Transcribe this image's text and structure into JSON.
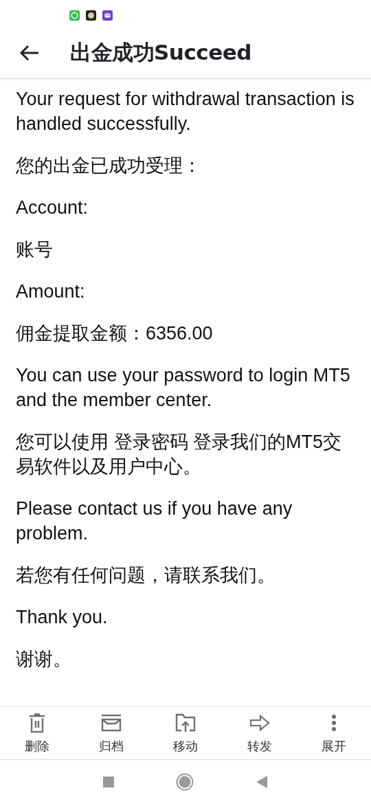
{
  "header": {
    "title": "出金成功Succeed"
  },
  "message": {
    "paragraphs": [
      "Your request for withdrawal transaction is handled successfully.",
      "您的出金已成功受理：",
      "Account:",
      "账号",
      "Amount:",
      "佣金提取金额：6356.00",
      "You can use your password to login MT5 and the member center.",
      "您可以使用 登录密码 登录我们的MT5交易软件以及用户中心。",
      "Please contact us if you have any problem.",
      "若您有任何问题，请联系我们。",
      "Thank you.",
      "谢谢。"
    ]
  },
  "toolbar": [
    {
      "kind": "trash",
      "label": "删除"
    },
    {
      "kind": "archive",
      "label": "归档"
    },
    {
      "kind": "move",
      "label": "移动"
    },
    {
      "kind": "forward",
      "label": "转发"
    },
    {
      "kind": "more",
      "label": "展开"
    }
  ]
}
